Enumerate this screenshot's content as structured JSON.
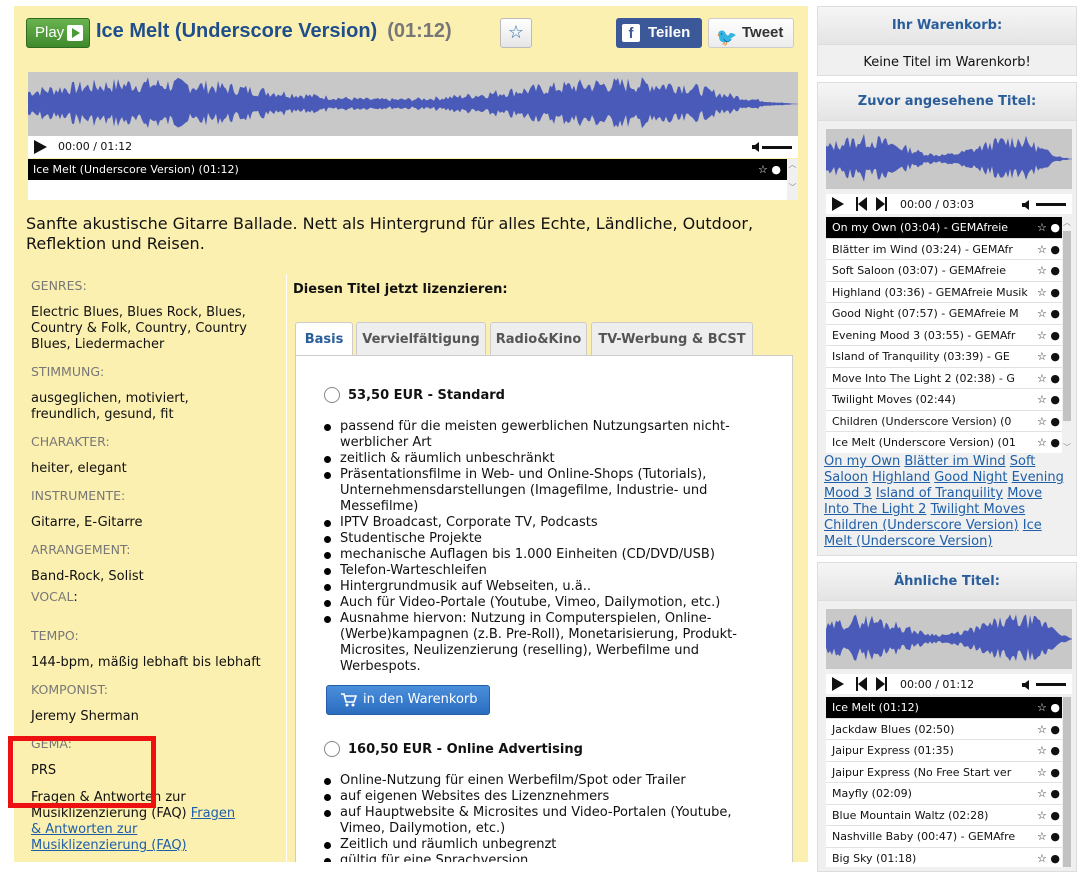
{
  "header": {
    "play_label": "Play",
    "title": "Ice Melt (Underscore Version)",
    "duration": "(01:12)",
    "facebook_label": "Teilen",
    "twitter_label": "Tweet"
  },
  "player": {
    "time": "00:00 / 01:12",
    "track": "Ice Melt (Underscore Version) (01:12)"
  },
  "description": "Sanfte akustische Gitarre Ballade. Nett als Hintergrund für alles Echte, Ländliche, Outdoor, Reflektion und Reisen.",
  "meta": {
    "genres_label": "GENRES:",
    "genres": "Electric Blues, Blues Rock, Blues, Country & Folk, Country, Country Blues, Liedermacher",
    "mood_label": "STIMMUNG:",
    "mood": "ausgeglichen, motiviert, freundlich, gesund, fit",
    "character_label": "CHARAKTER:",
    "character": "heiter, elegant",
    "instruments_label": "INSTRUMENTE:",
    "instruments": "Gitarre, E-Gitarre",
    "arrangement_label": "ARRANGEMENT:",
    "arrangement": "Band-Rock, Solist",
    "vocal_label": "VOCAL",
    "vocal_colon": ":",
    "tempo_label": "TEMPO:",
    "tempo": "144-bpm, mäßig lebhaft bis lebhaft",
    "composer_label": "KOMPONIST:",
    "composer": "Jeremy Sherman",
    "gema_label": "GEMA:",
    "gema": "PRS",
    "faq_text": "Fragen & Antworten zur Musiklizenzierung (FAQ)",
    "faq_link": "Fragen & Antworten zur Musiklizenzierung (FAQ)"
  },
  "license": {
    "heading": "Diesen Titel jetzt lizenzieren:",
    "tabs": [
      "Basis",
      "Vervielfältigung",
      "Radio&Kino",
      "TV-Werbung & BCST"
    ],
    "options": [
      {
        "label": "53,50 EUR - Standard",
        "features": [
          "passend für die meisten gewerblichen Nutzungsarten nicht-werblicher Art",
          "zeitlich & räumlich unbeschränkt",
          "Präsentationsfilme in Web- und Online-Shops (Tutorials), Unternehmensdarstellungen (Imagefilme, Industrie- und Messefilme)",
          "IPTV Broadcast, Corporate TV, Podcasts",
          "Studentische Projekte",
          "mechanische Auflagen bis 1.000 Einheiten (CD/DVD/USB)",
          "Telefon-Warteschleifen",
          "Hintergrundmusik auf Webseiten, u.ä..",
          "Auch für Video-Portale (Youtube, Vimeo, Dailymotion, etc.)",
          "Ausnahme hiervon: Nutzung in Computerspielen, Online-(Werbe)kampagnen (z.B. Pre-Roll), Monetarisierung, Produkt-Microsites, Neulizenzierung (reselling), Werbefilme und Werbespots."
        ]
      },
      {
        "label": "160,50 EUR - Online Advertising",
        "features": [
          "Online-Nutzung für einen Werbefilm/Spot oder Trailer",
          "auf eigenen Websites des Lizenznehmers",
          "auf Hauptwebsite & Microsites und Video-Portalen (Youtube, Vimeo, Dailymotion, etc.)",
          "Zeitlich und räumlich unbegrenzt",
          "gültig für eine Sprachversion"
        ]
      }
    ],
    "cart_button": "in den Warenkorb"
  },
  "cart": {
    "title": "Ihr Warenkorb:",
    "empty": "Keine Titel im Warenkorb!"
  },
  "recent": {
    "title": "Zuvor angesehene Titel:",
    "time": "00:00 / 03:03",
    "items": [
      "On my Own (03:04) - GEMAfreie",
      "Blätter im Wind (03:24) - GEMAfr",
      "Soft Saloon (03:07) - GEMAfreie",
      "Highland (03:36) - GEMAfreie Musik",
      "Good Night (07:57) - GEMAfreie M",
      "Evening Mood 3 (03:55) - GEMAfr",
      "Island of Tranquility (03:39) - GE",
      "Move Into The Light 2 (02:38) - G",
      "Twilight Moves (02:44)",
      "Children (Underscore Version) (0",
      "Ice Melt (Underscore Version) (01"
    ],
    "links": [
      "On my Own",
      "Blätter im Wind",
      "Soft Saloon",
      "Highland",
      "Good Night",
      "Evening Mood 3",
      "Island of Tranquility",
      "Move Into The Light 2",
      "Twilight Moves",
      "Children (Underscore Version)",
      "Ice Melt (Underscore Version)"
    ]
  },
  "similar": {
    "title": "Ähnliche Titel:",
    "time": "00:00 / 01:12",
    "items": [
      "Ice Melt (01:12)",
      "Jackdaw Blues (02:50)",
      "Jaipur Express (01:35)",
      "Jaipur Express (No Free Start ver",
      "Mayfly (02:09)",
      "Blue Mountain Waltz (02:28)",
      "Nashville Baby (00:47) - GEMAfre",
      "Big Sky (01:18)"
    ]
  }
}
